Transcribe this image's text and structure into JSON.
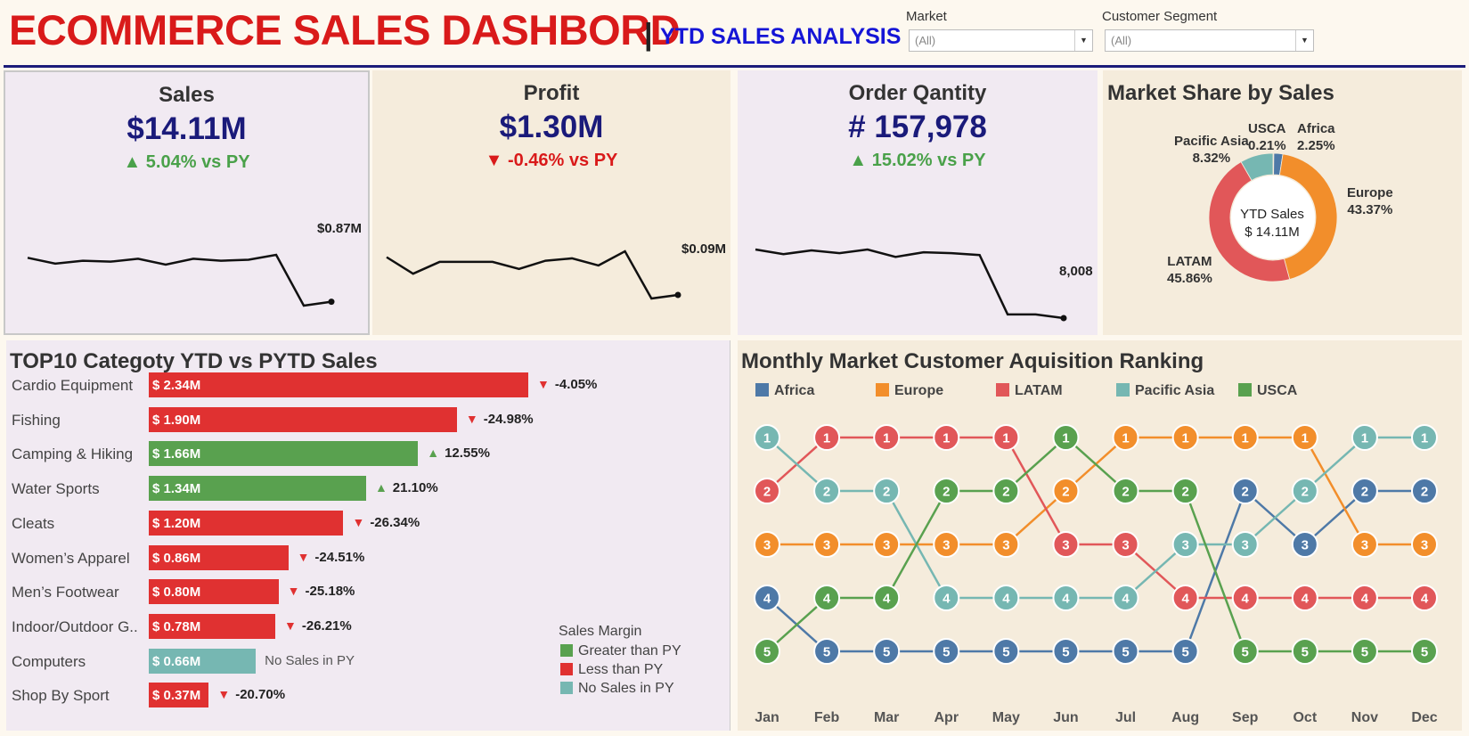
{
  "header": {
    "title": "ECOMMERCE SALES DASHBORD",
    "separator": "|",
    "subtitle": "YTD SALES ANALYSIS",
    "filters": [
      {
        "label": "Market",
        "value": "(All)"
      },
      {
        "label": "Customer Segment",
        "value": "(All)"
      }
    ]
  },
  "colors": {
    "title_red": "#d91a1a",
    "subtitle_blue": "#1515d6",
    "kpi_blue": "#1a1a7a",
    "up_green": "#4aa14a",
    "down_red": "#d91a1a",
    "bar_green": "#59a14f",
    "bar_red": "#e03131",
    "bar_teal": "#76b7b2",
    "africa": "#4e79a7",
    "europe": "#f28e2b",
    "latam": "#e15759",
    "pacific_asia": "#76b7b2",
    "usca": "#59a14f"
  },
  "kpis": [
    {
      "title": "Sales",
      "value": "$14.11M",
      "arrow": "▲",
      "change": "5.04% vs PY",
      "direction": "up",
      "last_label": "$0.87M",
      "trend": [
        1.32,
        1.26,
        1.29,
        1.28,
        1.31,
        1.25,
        1.31,
        1.29,
        1.3,
        1.35,
        0.83,
        0.87
      ]
    },
    {
      "title": "Profit",
      "value": "$1.30M",
      "arrow": "▼",
      "change": "-0.46% vs PY",
      "direction": "down",
      "last_label": "$0.09M",
      "trend": [
        0.122,
        0.108,
        0.118,
        0.118,
        0.118,
        0.112,
        0.119,
        0.121,
        0.115,
        0.127,
        0.087,
        0.09
      ]
    },
    {
      "title": "Order Qantity",
      "value": "# 157,978",
      "arrow": "▲",
      "change": "15.02% vs PY",
      "direction": "up",
      "last_label": "8,008",
      "trend": [
        15.4,
        14.9,
        15.3,
        15.0,
        15.4,
        14.6,
        15.1,
        15.0,
        14.8,
        8.4,
        8.4,
        8.0
      ]
    }
  ],
  "market_share": {
    "title": "Market Share by Sales",
    "center_line1": "YTD Sales",
    "center_line2": "$ 14.11M",
    "slices": [
      {
        "name": "USCA",
        "percent": 0.21,
        "pct_label": "0.21%"
      },
      {
        "name": "Africa",
        "percent": 2.25,
        "pct_label": "2.25%"
      },
      {
        "name": "Europe",
        "percent": 43.37,
        "pct_label": "43.37%"
      },
      {
        "name": "LATAM",
        "percent": 45.86,
        "pct_label": "45.86%"
      },
      {
        "name": "Pacific Asia",
        "percent": 8.32,
        "pct_label": "8.32%"
      }
    ]
  },
  "top10": {
    "title": "TOP10 Categoty YTD vs PYTD Sales",
    "value_max": 2.5,
    "rows": [
      {
        "category": "Cardio Equipment",
        "value": 2.34,
        "value_label": "$ 2.34M",
        "status": "less",
        "arrow": "▼",
        "change": "-4.05%"
      },
      {
        "category": "Fishing",
        "value": 1.9,
        "value_label": "$ 1.90M",
        "status": "less",
        "arrow": "▼",
        "change": "-24.98%"
      },
      {
        "category": "Camping & Hiking",
        "value": 1.66,
        "value_label": "$ 1.66M",
        "status": "greater",
        "arrow": "▲",
        "change": "12.55%"
      },
      {
        "category": "Water Sports",
        "value": 1.34,
        "value_label": "$ 1.34M",
        "status": "greater",
        "arrow": "▲",
        "change": "21.10%"
      },
      {
        "category": "Cleats",
        "value": 1.2,
        "value_label": "$ 1.20M",
        "status": "less",
        "arrow": "▼",
        "change": "-26.34%"
      },
      {
        "category": "Women’s Apparel",
        "value": 0.86,
        "value_label": "$ 0.86M",
        "status": "less",
        "arrow": "▼",
        "change": "-24.51%"
      },
      {
        "category": "Men’s Footwear",
        "value": 0.8,
        "value_label": "$ 0.80M",
        "status": "less",
        "arrow": "▼",
        "change": "-25.18%"
      },
      {
        "category": "Indoor/Outdoor G..",
        "value": 0.78,
        "value_label": "$ 0.78M",
        "status": "less",
        "arrow": "▼",
        "change": "-26.21%"
      },
      {
        "category": "Computers",
        "value": 0.66,
        "value_label": "$ 0.66M",
        "status": "none",
        "arrow": "",
        "change": "No Sales in PY"
      },
      {
        "category": "Shop By Sport",
        "value": 0.37,
        "value_label": "$ 0.37M",
        "status": "less",
        "arrow": "▼",
        "change": "-20.70%"
      }
    ],
    "legend": {
      "title": "Sales Margin",
      "items": [
        {
          "label": "Greater than PY",
          "status": "greater"
        },
        {
          "label": "Less than PY",
          "status": "less"
        },
        {
          "label": "No Sales in PY",
          "status": "none"
        }
      ]
    }
  },
  "chart_data": {
    "type": "line",
    "title": "Monthly Market Customer Aquisition Ranking",
    "x": [
      "Jan",
      "Feb",
      "Mar",
      "Apr",
      "May",
      "Jun",
      "Jul",
      "Aug",
      "Sep",
      "Oct",
      "Nov",
      "Dec"
    ],
    "ylim": [
      1,
      5
    ],
    "series": [
      {
        "name": "Africa",
        "values": [
          4,
          5,
          5,
          5,
          5,
          5,
          5,
          5,
          2,
          3,
          2,
          2
        ]
      },
      {
        "name": "Europe",
        "values": [
          3,
          3,
          3,
          3,
          3,
          2,
          1,
          1,
          1,
          1,
          3,
          3
        ]
      },
      {
        "name": "LATAM",
        "values": [
          2,
          1,
          1,
          1,
          1,
          3,
          3,
          4,
          4,
          4,
          4,
          4
        ]
      },
      {
        "name": "Pacific Asia",
        "values": [
          1,
          2,
          2,
          4,
          4,
          4,
          4,
          3,
          3,
          2,
          1,
          1
        ]
      },
      {
        "name": "USCA",
        "values": [
          5,
          4,
          4,
          2,
          2,
          1,
          2,
          2,
          5,
          5,
          5,
          5
        ]
      }
    ]
  }
}
